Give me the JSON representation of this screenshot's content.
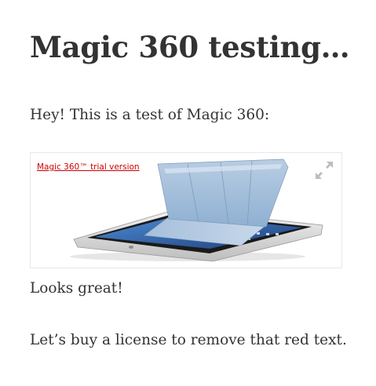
{
  "post": {
    "title": "Magic 360 testing…",
    "intro": "Hey! This is a test of Magic 360:",
    "after_image": "Looks great!",
    "closing": "Let’s buy a license to remove that red text."
  },
  "magic360": {
    "trial_label": "Magic 360™ trial version",
    "expand_icon": "expand-arrows-icon",
    "image_subject": "tablet-with-smart-cover",
    "trial_color": "#cc0000"
  }
}
